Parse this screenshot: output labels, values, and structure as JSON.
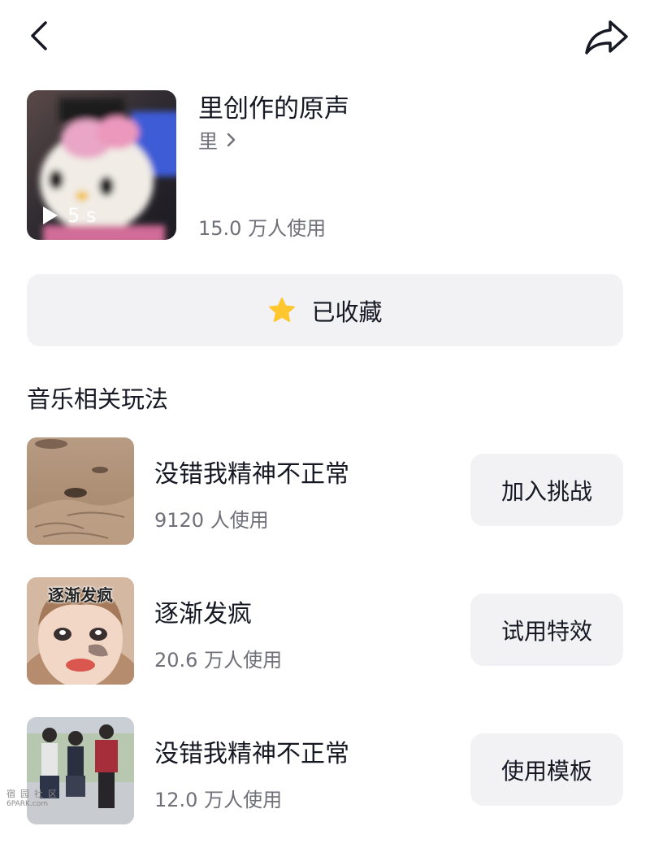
{
  "header": {
    "back_icon": "chevron-left-icon",
    "share_icon": "share-arrow-icon"
  },
  "sound": {
    "title": "里创作的原声",
    "author": "里",
    "duration": "5 s",
    "usage": "15.0 万人使用"
  },
  "favorite": {
    "label": "已收藏",
    "icon": "star-icon",
    "icon_color": "#FFC62E"
  },
  "section": {
    "title": "音乐相关玩法"
  },
  "items": [
    {
      "title": "没错我精神不正常",
      "count": "9120 人使用",
      "action": "加入挑战"
    },
    {
      "title": "逐渐发疯",
      "count": "20.6 万人使用",
      "action": "试用特效",
      "thumb_caption": "逐渐发疯"
    },
    {
      "title": "没错我精神不正常",
      "count": "12.0 万人使用",
      "action": "使用模板"
    }
  ],
  "watermark": {
    "line1": "宿园社区",
    "line2": "6PARK.com"
  }
}
